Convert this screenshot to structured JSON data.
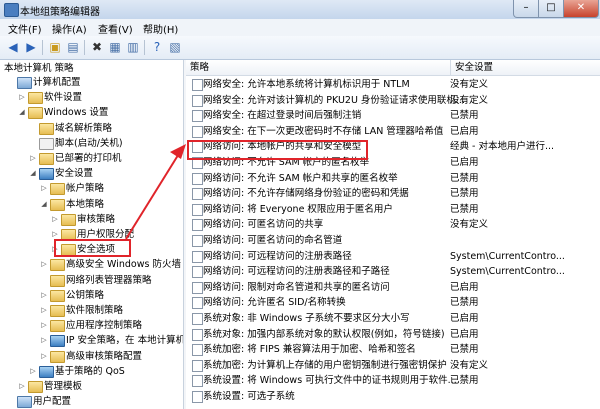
{
  "window": {
    "title": "本地组策略编辑器",
    "min": "–",
    "max": "□",
    "close": "✕"
  },
  "menu": [
    "文件(F)",
    "操作(A)",
    "查看(V)",
    "帮助(H)"
  ],
  "tree": {
    "header": "本地计算机 策略",
    "items": [
      {
        "label": "计算机配置",
        "icon": "computer-icon",
        "expander": "",
        "depth": 0
      },
      {
        "label": "软件设置",
        "icon": "folder-icon",
        "expander": "▷",
        "depth": 1
      },
      {
        "label": "Windows 设置",
        "icon": "folder-icon",
        "expander": "◢",
        "depth": 1
      },
      {
        "label": "域名解析策略",
        "icon": "folder-icon",
        "expander": "",
        "depth": 2
      },
      {
        "label": "脚本(启动/关机)",
        "icon": "document-icon",
        "expander": "",
        "depth": 2
      },
      {
        "label": "已部署的打印机",
        "icon": "folder-icon",
        "expander": "▷",
        "depth": 2
      },
      {
        "label": "安全设置",
        "icon": "shield-icon",
        "expander": "◢",
        "depth": 2
      },
      {
        "label": "帐户策略",
        "icon": "folder-icon",
        "expander": "▷",
        "depth": 3
      },
      {
        "label": "本地策略",
        "icon": "folder-icon",
        "expander": "◢",
        "depth": 3
      },
      {
        "label": "审核策略",
        "icon": "folder-icon",
        "expander": "▷",
        "depth": 4
      },
      {
        "label": "用户权限分配",
        "icon": "folder-icon",
        "expander": "▷",
        "depth": 4
      },
      {
        "label": "安全选项",
        "icon": "folder-icon",
        "expander": "▷",
        "depth": 4
      },
      {
        "label": "高级安全 Windows 防火墙",
        "icon": "folder-icon",
        "expander": "▷",
        "depth": 3
      },
      {
        "label": "网络列表管理器策略",
        "icon": "folder-icon",
        "expander": "",
        "depth": 3
      },
      {
        "label": "公钥策略",
        "icon": "folder-icon",
        "expander": "▷",
        "depth": 3
      },
      {
        "label": "软件限制策略",
        "icon": "folder-icon",
        "expander": "▷",
        "depth": 3
      },
      {
        "label": "应用程序控制策略",
        "icon": "folder-icon",
        "expander": "▷",
        "depth": 3
      },
      {
        "label": "IP 安全策略，在 本地计算机",
        "icon": "shield-icon",
        "expander": "▷",
        "depth": 3
      },
      {
        "label": "高级审核策略配置",
        "icon": "folder-icon",
        "expander": "▷",
        "depth": 3
      },
      {
        "label": "基于策略的 QoS",
        "icon": "chart-icon",
        "expander": "▷",
        "depth": 2
      },
      {
        "label": "管理模板",
        "icon": "folder-icon",
        "expander": "▷",
        "depth": 1
      },
      {
        "label": "用户配置",
        "icon": "computer-icon",
        "expander": "",
        "depth": 0
      }
    ]
  },
  "list": {
    "columns": {
      "policy": "策略",
      "setting": "安全设置"
    },
    "rows": [
      {
        "policy": "网络安全: 允许本地系统将计算机标识用于 NTLM",
        "setting": "没有定义"
      },
      {
        "policy": "网络安全: 允许对该计算机的 PKU2U 身份验证请求使用联机...",
        "setting": "没有定义"
      },
      {
        "policy": "网络安全: 在超过登录时间后强制注销",
        "setting": "已禁用"
      },
      {
        "policy": "网络安全: 在下一次更改密码时不存储 LAN 管理器哈希值",
        "setting": "已启用"
      },
      {
        "policy": "网络访问: 本地帐户的共享和安全模型",
        "setting": "经典 - 对本地用户进行..."
      },
      {
        "policy": "网络访问: 不允许 SAM 帐户的匿名枚举",
        "setting": "已启用"
      },
      {
        "policy": "网络访问: 不允许 SAM 帐户和共享的匿名枚举",
        "setting": "已禁用"
      },
      {
        "policy": "网络访问: 不允许存储网络身份验证的密码和凭据",
        "setting": "已禁用"
      },
      {
        "policy": "网络访问: 将 Everyone 权限应用于匿名用户",
        "setting": "已禁用"
      },
      {
        "policy": "网络访问: 可匿名访问的共享",
        "setting": "没有定义"
      },
      {
        "policy": "网络访问: 可匿名访问的命名管道",
        "setting": ""
      },
      {
        "policy": "网络访问: 可远程访问的注册表路径",
        "setting": "System\\CurrentContro..."
      },
      {
        "policy": "网络访问: 可远程访问的注册表路径和子路径",
        "setting": "System\\CurrentContro..."
      },
      {
        "policy": "网络访问: 限制对命名管道和共享的匿名访问",
        "setting": "已启用"
      },
      {
        "policy": "网络访问: 允许匿名 SID/名称转换",
        "setting": "已禁用"
      },
      {
        "policy": "系统对象: 非 Windows 子系统不要求区分大小写",
        "setting": "已启用"
      },
      {
        "policy": "系统对象: 加强内部系统对象的默认权限(例如，符号链接)",
        "setting": "已启用"
      },
      {
        "policy": "系统加密: 将 FIPS 兼容算法用于加密、哈希和签名",
        "setting": "已禁用"
      },
      {
        "policy": "系统加密: 为计算机上存储的用户密钥强制进行强密钥保护",
        "setting": "没有定义"
      },
      {
        "policy": "系统设置: 将 Windows 可执行文件中的证书规则用于软件...",
        "setting": "已禁用"
      },
      {
        "policy": "系统设置: 可选子系统",
        "setting": ""
      }
    ]
  }
}
